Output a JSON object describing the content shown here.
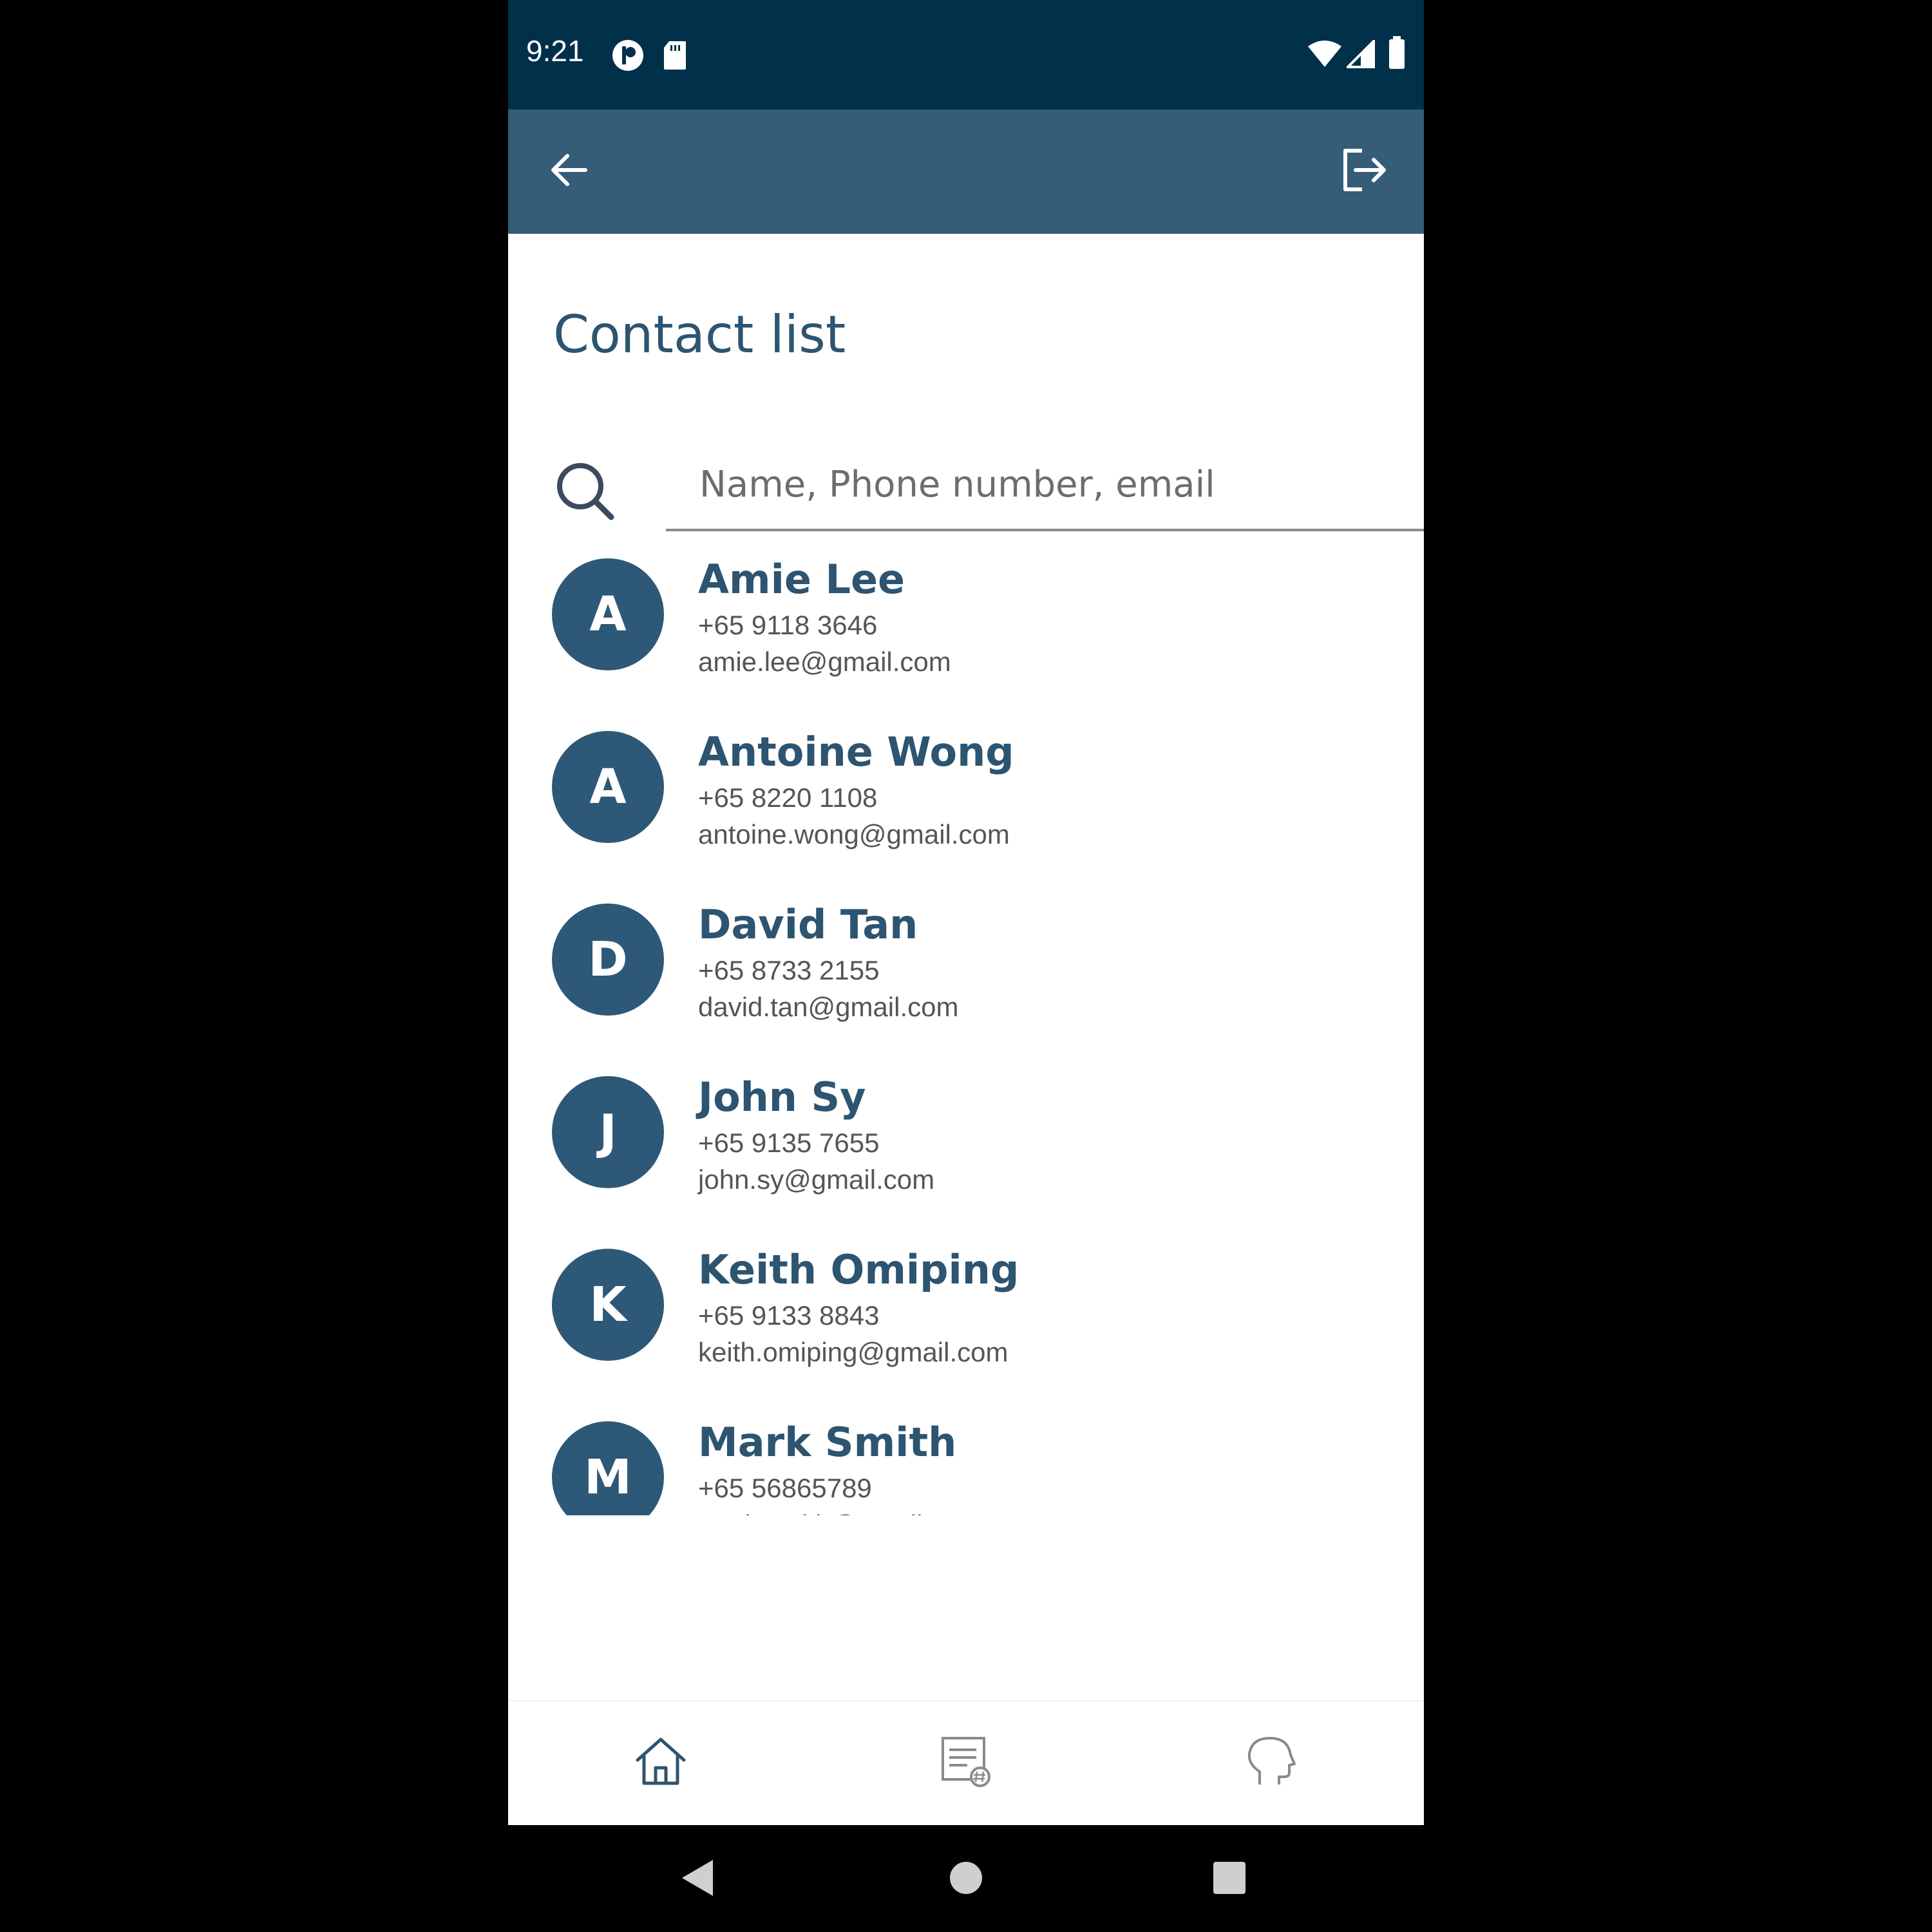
{
  "status_bar": {
    "time": "9:21",
    "icons": [
      "p-app-icon",
      "sd-card-icon",
      "wifi-icon",
      "signal-icon",
      "battery-icon"
    ]
  },
  "app_bar": {
    "back_icon": "back-arrow-icon",
    "logout_icon": "logout-icon",
    "background": "#355d78"
  },
  "page": {
    "title": "Contact list"
  },
  "search": {
    "placeholder": "Name, Phone number, email",
    "value": "",
    "icon": "search-icon"
  },
  "contacts": [
    {
      "initial": "A",
      "name": "Amie Lee",
      "phone": "+65 9118 3646",
      "email": "amie.lee@gmail.com"
    },
    {
      "initial": "A",
      "name": "Antoine Wong",
      "phone": "+65 8220 1108",
      "email": "antoine.wong@gmail.com"
    },
    {
      "initial": "D",
      "name": "David Tan",
      "phone": "+65 8733 2155",
      "email": "david.tan@gmail.com"
    },
    {
      "initial": "J",
      "name": "John Sy",
      "phone": "+65 9135 7655",
      "email": "john.sy@gmail.com"
    },
    {
      "initial": "K",
      "name": "Keith Omiping",
      "phone": "+65 9133 8843",
      "email": "keith.omiping@gmail.com"
    },
    {
      "initial": "M",
      "name": "Mark Smith",
      "phone": "+65 56865789",
      "email": "mark.smith@gmail.com"
    }
  ],
  "bottom_nav": {
    "items": [
      "home-icon",
      "document-hash-icon",
      "head-profile-icon"
    ]
  },
  "system_nav": {
    "items": [
      "back-triangle-icon",
      "home-circle-icon",
      "recents-square-icon"
    ]
  },
  "colors": {
    "status_bar": "#01304a",
    "accent": "#2d5470",
    "avatar": "#2e5877"
  }
}
